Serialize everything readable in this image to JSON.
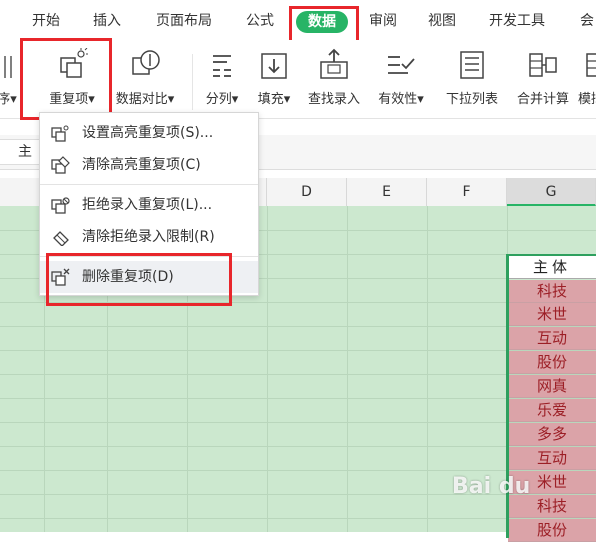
{
  "menu": {
    "items": [
      "开始",
      "插入",
      "页面布局",
      "公式",
      "数据",
      "审阅",
      "视图",
      "开发工具",
      "会"
    ],
    "active": "数据"
  },
  "ribbon": {
    "partial_left_label": "序",
    "tools": [
      {
        "label": "重复项",
        "has_arrow": true,
        "icon": "duplicates-icon"
      },
      {
        "label": "数据对比",
        "has_arrow": true,
        "icon": "data-compare-icon"
      },
      {
        "label": "分列",
        "has_arrow": true,
        "icon": "split-columns-icon"
      },
      {
        "label": "填充",
        "has_arrow": true,
        "icon": "fill-icon"
      },
      {
        "label": "查找录入",
        "has_arrow": false,
        "icon": "lookup-entry-icon"
      },
      {
        "label": "有效性",
        "has_arrow": true,
        "icon": "validity-icon"
      },
      {
        "label": "下拉列表",
        "has_arrow": false,
        "icon": "dropdown-list-icon"
      },
      {
        "label": "合并计算",
        "has_arrow": false,
        "icon": "consolidate-icon"
      },
      {
        "label": "模拟",
        "has_arrow": false,
        "icon": "simulate-icon"
      }
    ],
    "arrow_glyph": "▾"
  },
  "formula_bar": {
    "name_box": "主"
  },
  "dropdown": {
    "items": [
      {
        "label": "设置高亮重复项(S)...",
        "icon": "highlight-duplicates-icon"
      },
      {
        "label": "清除高亮重复项(C)",
        "icon": "clear-highlight-icon"
      },
      {
        "label": "拒绝录入重复项(L)...",
        "icon": "reject-duplicates-icon"
      },
      {
        "label": "清除拒绝录入限制(R)",
        "icon": "clear-reject-icon"
      },
      {
        "label": "删除重复项(D)",
        "icon": "delete-duplicates-icon"
      }
    ]
  },
  "sheet": {
    "columns": [
      "D",
      "E",
      "F",
      "G"
    ],
    "selected_column": "G",
    "header_cell": "主体",
    "cells": [
      "科技",
      "米世",
      "互动",
      "股份",
      "网真",
      "乐爱",
      "多多",
      "互动",
      "米世",
      "科技",
      "股份"
    ]
  },
  "watermark": "Bai du",
  "colors": {
    "accent": "#27b466",
    "highlight_box": "#e8262b",
    "dup_fill": "#dba3a8",
    "dup_text": "#9c1f26",
    "grid": "#cce8cf"
  }
}
